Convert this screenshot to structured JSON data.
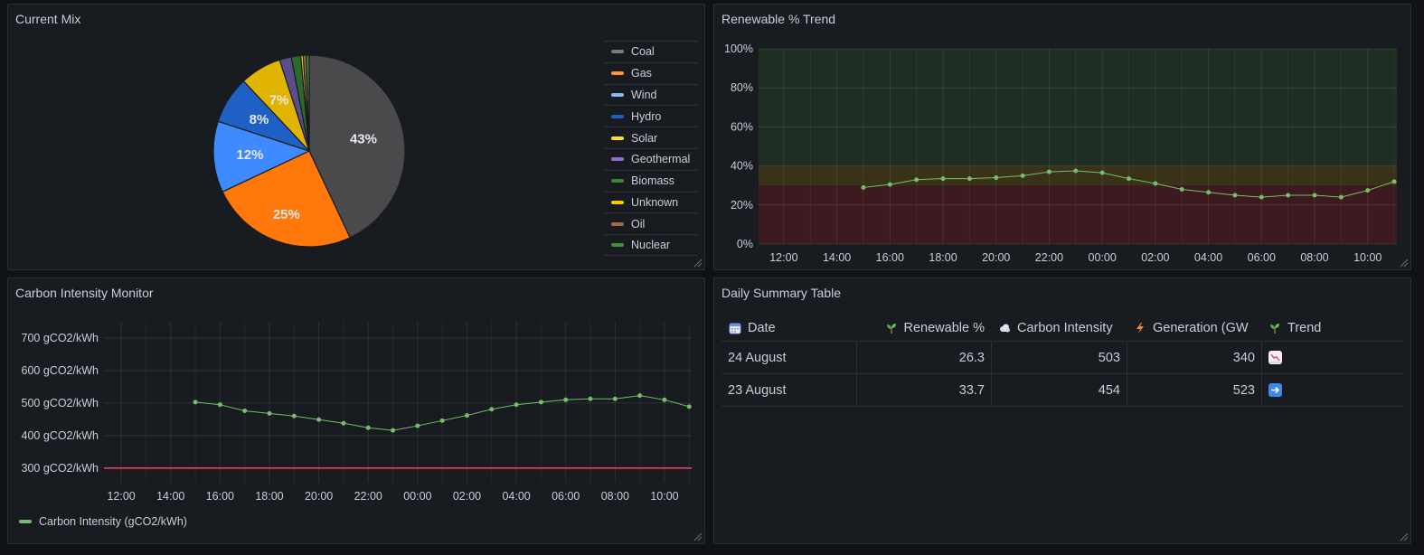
{
  "panels": {
    "current_mix": {
      "title": "Current Mix"
    },
    "renewable_trend": {
      "title": "Renewable % Trend"
    },
    "carbon_monitor": {
      "title": "Carbon Intensity Monitor"
    },
    "daily_summary": {
      "title": "Daily Summary Table"
    }
  },
  "pie_legend": [
    {
      "label": "Coal",
      "color": "#7a7a7a"
    },
    {
      "label": "Gas",
      "color": "#ff9830"
    },
    {
      "label": "Wind",
      "color": "#8ab8ff"
    },
    {
      "label": "Hydro",
      "color": "#1f60c4"
    },
    {
      "label": "Solar",
      "color": "#fade2a"
    },
    {
      "label": "Geothermal",
      "color": "#8f6bd0"
    },
    {
      "label": "Biomass",
      "color": "#37872d"
    },
    {
      "label": "Unknown",
      "color": "#f2cc0c"
    },
    {
      "label": "Oil",
      "color": "#a16c3e"
    },
    {
      "label": "Nuclear",
      "color": "#3e8f38"
    }
  ],
  "line_legend": {
    "label": "Carbon Intensity (gCO2/kWh)",
    "color": "#73bf69"
  },
  "table": {
    "headers": {
      "date": "Date",
      "renewable": "Renewable %",
      "carbon": "Carbon Intensity",
      "generation": "Generation (GW",
      "trend": "Trend"
    },
    "rows": [
      {
        "date": "24 August",
        "renewable": "26.3",
        "carbon": "503",
        "generation": "340",
        "trend": "down"
      },
      {
        "date": "23 August",
        "renewable": "33.7",
        "carbon": "454",
        "generation": "523",
        "trend": "right"
      }
    ]
  },
  "chart_data": [
    {
      "type": "pie",
      "panel": "Current Mix",
      "categories": [
        "Coal",
        "Gas",
        "Wind",
        "Hydro",
        "Solar",
        "Geothermal",
        "Biomass",
        "Unknown",
        "Oil",
        "Nuclear"
      ],
      "values": [
        43,
        25,
        12,
        8,
        7,
        2,
        1.6,
        0.4,
        0.5,
        0.5
      ],
      "colors": [
        "#4a4a4d",
        "#ff780a",
        "#3d8bff",
        "#1f60c4",
        "#e0b400",
        "#5a4d8a",
        "#2a6a2a",
        "#f2cc0c",
        "#a16c3e",
        "#3e8f38"
      ],
      "data_labels": [
        "43%",
        "25%",
        "12%",
        "8%",
        "7%"
      ]
    },
    {
      "type": "line",
      "panel": "Renewable % Trend",
      "x_ticks": [
        "12:00",
        "14:00",
        "16:00",
        "18:00",
        "20:00",
        "22:00",
        "00:00",
        "02:00",
        "04:00",
        "06:00",
        "08:00",
        "10:00"
      ],
      "y_ticks": [
        "0%",
        "20%",
        "40%",
        "60%",
        "80%",
        "100%"
      ],
      "ylim": [
        0,
        100
      ],
      "x_range_hours": [
        11,
        34.2
      ],
      "series": [
        {
          "color": "#73bf69",
          "x_hours": [
            15,
            16,
            17,
            18,
            19,
            20,
            21,
            22,
            23,
            24,
            25,
            26,
            27,
            28,
            29,
            30,
            31,
            32,
            33,
            34,
            35
          ],
          "values": [
            29,
            30.5,
            33,
            33.5,
            33.5,
            34,
            35,
            37,
            37.5,
            36.5,
            33.5,
            31,
            28,
            26.5,
            25,
            24,
            25,
            25,
            24,
            27.5,
            32
          ]
        }
      ],
      "threshold_bands": [
        {
          "from": 0,
          "to": 30,
          "color": "#3d1a1f"
        },
        {
          "from": 30,
          "to": 40,
          "color": "#3a3218"
        },
        {
          "from": 40,
          "to": 100,
          "color": "#1f2e22"
        }
      ]
    },
    {
      "type": "line",
      "panel": "Carbon Intensity Monitor",
      "x_ticks": [
        "12:00",
        "14:00",
        "16:00",
        "18:00",
        "20:00",
        "22:00",
        "00:00",
        "02:00",
        "04:00",
        "06:00",
        "08:00",
        "10:00"
      ],
      "y_ticks": [
        "300 gCO2/kWh",
        "400 gCO2/kWh",
        "500 gCO2/kWh",
        "600 gCO2/kWh",
        "700 gCO2/kWh"
      ],
      "ylim": [
        255,
        750
      ],
      "series": [
        {
          "name": "Carbon Intensity (gCO2/kWh)",
          "color": "#73bf69",
          "x_hours": [
            15,
            16,
            17,
            18,
            19,
            20,
            21,
            22,
            23,
            24,
            25,
            26,
            27,
            28,
            29,
            30,
            31,
            32,
            33,
            34,
            35
          ],
          "values": [
            503,
            495,
            476,
            468,
            460,
            449,
            438,
            424,
            416,
            430,
            446,
            462,
            481,
            495,
            503,
            510,
            513,
            513,
            523,
            510,
            489
          ]
        }
      ],
      "threshold_line": {
        "value": 300,
        "color": "#f2495c"
      }
    }
  ]
}
